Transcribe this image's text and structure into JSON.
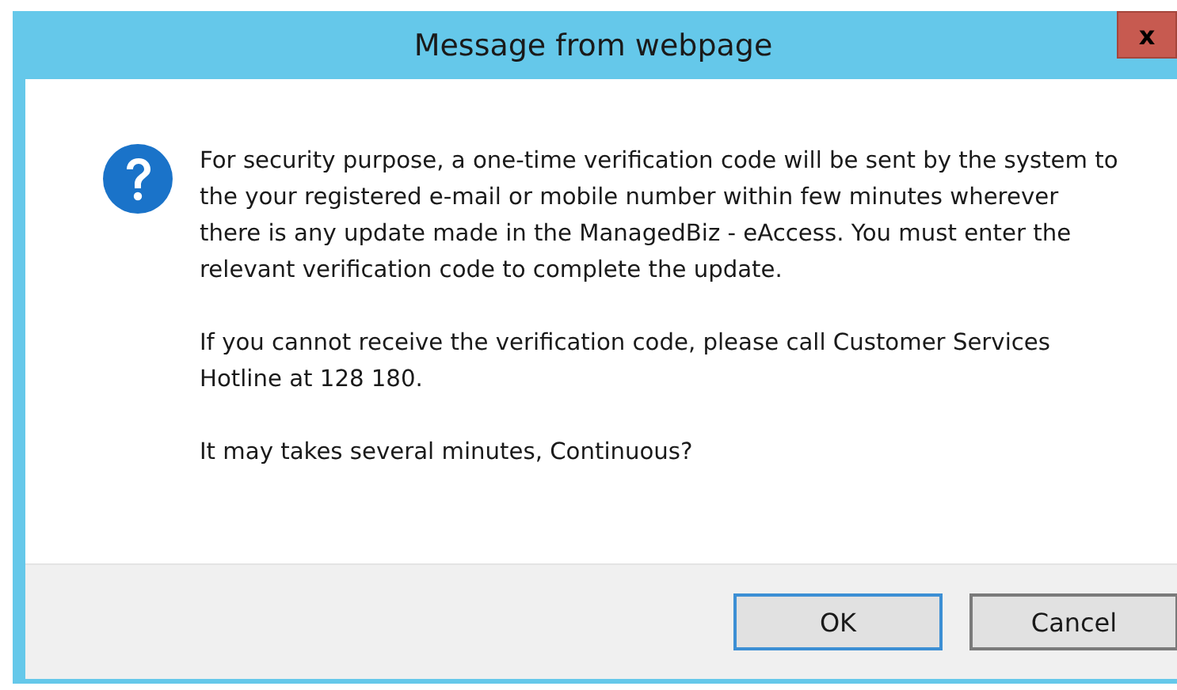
{
  "window": {
    "title": "Message from webpage",
    "close_label": "x"
  },
  "message": {
    "paragraphs": [
      "For security purpose, a one-time verification code will be sent by the system to the your registered e-mail or mobile number within few minutes wherever there is any update made in the ManagedBiz - eAccess. You must enter the relevant verification code to complete the update.",
      "If you cannot receive the verification code, please call  Customer Services Hotline at 128 180.",
      "It may takes several minutes, Continuous?"
    ]
  },
  "buttons": [
    {
      "label": "OK",
      "default": true
    },
    {
      "label": "Cancel",
      "default": false
    }
  ]
}
